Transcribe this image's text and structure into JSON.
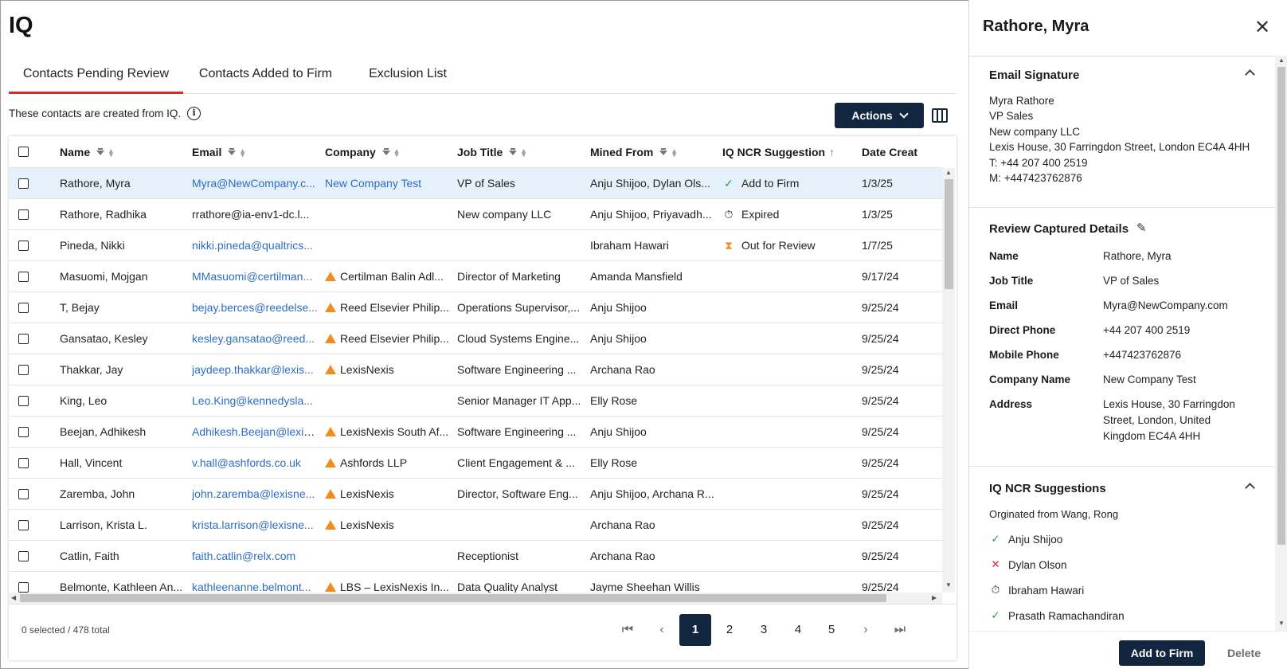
{
  "app": {
    "title": "IQ"
  },
  "tabs": [
    {
      "label": "Contacts Pending Review",
      "active": true
    },
    {
      "label": "Contacts Added to Firm",
      "active": false
    },
    {
      "label": "Exclusion List",
      "active": false
    }
  ],
  "info": {
    "text": "These contacts are created from IQ.",
    "icon": "info-icon"
  },
  "toolbar": {
    "actions_label": "Actions",
    "columns_icon": "columns-icon"
  },
  "table": {
    "columns": [
      "Name",
      "Email",
      "Company",
      "Job Title",
      "Mined From",
      "IQ NCR Suggestion",
      "Date Creat"
    ],
    "rows": [
      {
        "name": "Rathore, Myra",
        "email": "Myra@NewCompany.c...",
        "email_link": true,
        "company": "New Company Test",
        "company_link": true,
        "company_warn": false,
        "job": "VP of Sales",
        "mined": "Anju Shijoo, Dylan Ols...",
        "suggestion": "Add to Firm",
        "sug_icon": "check-icon",
        "date": "1/3/25",
        "selected": true
      },
      {
        "name": "Rathore, Radhika",
        "email": "rrathore@ia-env1-dc.l...",
        "email_link": false,
        "company": "",
        "company_link": false,
        "company_warn": false,
        "job": "New company LLC",
        "mined": "Anju Shijoo, Priyavadh...",
        "suggestion": "Expired",
        "sug_icon": "timer-icon",
        "date": "1/3/25",
        "selected": false
      },
      {
        "name": "Pineda, Nikki",
        "email": "nikki.pineda@qualtrics...",
        "email_link": true,
        "company": "",
        "company_link": false,
        "company_warn": false,
        "job": "",
        "mined": "Ibraham Hawari",
        "suggestion": "Out for Review",
        "sug_icon": "hourglass-icon",
        "date": "1/7/25",
        "selected": false
      },
      {
        "name": "Masuomi, Mojgan",
        "email": "MMasuomi@certilman...",
        "email_link": true,
        "company": "Certilman Balin Adl...",
        "company_link": false,
        "company_warn": true,
        "job": "Director of Marketing",
        "mined": "Amanda Mansfield",
        "suggestion": "",
        "sug_icon": "",
        "date": "9/17/24",
        "selected": false
      },
      {
        "name": "T, Bejay",
        "email": "bejay.berces@reedelse...",
        "email_link": true,
        "company": "Reed Elsevier Philip...",
        "company_link": false,
        "company_warn": true,
        "job": "Operations Supervisor,...",
        "mined": "Anju Shijoo",
        "suggestion": "",
        "sug_icon": "",
        "date": "9/25/24",
        "selected": false
      },
      {
        "name": "Gansatao, Kesley",
        "email": "kesley.gansatao@reed...",
        "email_link": true,
        "company": "Reed Elsevier Philip...",
        "company_link": false,
        "company_warn": true,
        "job": "Cloud Systems Engine...",
        "mined": "Anju Shijoo",
        "suggestion": "",
        "sug_icon": "",
        "date": "9/25/24",
        "selected": false
      },
      {
        "name": "Thakkar, Jay",
        "email": "jaydeep.thakkar@lexis...",
        "email_link": true,
        "company": "LexisNexis",
        "company_link": false,
        "company_warn": true,
        "job": "Software Engineering ...",
        "mined": "Archana Rao",
        "suggestion": "",
        "sug_icon": "",
        "date": "9/25/24",
        "selected": false
      },
      {
        "name": "King, Leo",
        "email": "Leo.King@kennedysla...",
        "email_link": true,
        "company": "",
        "company_link": false,
        "company_warn": false,
        "job": "Senior Manager IT App...",
        "mined": "Elly Rose",
        "suggestion": "",
        "sug_icon": "",
        "date": "9/25/24",
        "selected": false
      },
      {
        "name": "Beejan, Adhikesh",
        "email": "Adhikesh.Beejan@lexis...",
        "email_link": true,
        "company": "LexisNexis South Af...",
        "company_link": false,
        "company_warn": true,
        "job": "Software Engineering ...",
        "mined": "Anju Shijoo",
        "suggestion": "",
        "sug_icon": "",
        "date": "9/25/24",
        "selected": false
      },
      {
        "name": "Hall, Vincent",
        "email": "v.hall@ashfords.co.uk",
        "email_link": true,
        "company": "Ashfords LLP",
        "company_link": false,
        "company_warn": true,
        "job": "Client Engagement & ...",
        "mined": "Elly Rose",
        "suggestion": "",
        "sug_icon": "",
        "date": "9/25/24",
        "selected": false
      },
      {
        "name": "Zaremba, John",
        "email": "john.zaremba@lexisne...",
        "email_link": true,
        "company": "LexisNexis",
        "company_link": false,
        "company_warn": true,
        "job": "Director, Software Eng...",
        "mined": "Anju Shijoo, Archana R...",
        "suggestion": "",
        "sug_icon": "",
        "date": "9/25/24",
        "selected": false
      },
      {
        "name": "Larrison, Krista L.",
        "email": "krista.larrison@lexisne...",
        "email_link": true,
        "company": "LexisNexis",
        "company_link": false,
        "company_warn": true,
        "job": "",
        "mined": "Archana Rao",
        "suggestion": "",
        "sug_icon": "",
        "date": "9/25/24",
        "selected": false
      },
      {
        "name": "Catlin, Faith",
        "email": "faith.catlin@relx.com",
        "email_link": true,
        "company": "",
        "company_link": false,
        "company_warn": false,
        "job": "Receptionist",
        "mined": "Archana Rao",
        "suggestion": "",
        "sug_icon": "",
        "date": "9/25/24",
        "selected": false
      },
      {
        "name": "Belmonte, Kathleen An...",
        "email": "kathleenanne.belmont...",
        "email_link": true,
        "company": "LBS – LexisNexis In...",
        "company_link": false,
        "company_warn": true,
        "job": "Data Quality Analyst",
        "mined": "Jayme Sheehan Willis",
        "suggestion": "",
        "sug_icon": "",
        "date": "9/25/24",
        "selected": false
      }
    ]
  },
  "footer": {
    "count_text": "0 selected / 478 total",
    "pages": [
      "1",
      "2",
      "3",
      "4",
      "5"
    ],
    "current_page": "1"
  },
  "panel": {
    "title": "Rathore, Myra",
    "signature": {
      "title": "Email Signature",
      "lines": [
        "Myra Rathore",
        "VP Sales",
        "New company LLC",
        "Lexis House, 30 Farringdon Street, London EC4A 4HH",
        "T: +44 207 400 2519",
        "M: +447423762876"
      ]
    },
    "review": {
      "title": "Review Captured Details",
      "fields": [
        {
          "label": "Name",
          "value": "Rathore, Myra",
          "link": false
        },
        {
          "label": "Job Title",
          "value": "VP of Sales",
          "link": false
        },
        {
          "label": "Email",
          "value": "Myra@NewCompany.com",
          "link": false
        },
        {
          "label": "Direct Phone",
          "value": "+44 207 400 2519",
          "link": false
        },
        {
          "label": "Mobile Phone",
          "value": "+447423762876",
          "link": false
        },
        {
          "label": "Company Name",
          "value": "New Company Test",
          "link": true
        },
        {
          "label": "Address",
          "value": "Lexis House, 30 Farringdon Street, London, United Kingdom EC4A 4HH",
          "link": false
        }
      ]
    },
    "suggestions": {
      "title": "IQ NCR Suggestions",
      "origin": "Orginated from Wang, Rong",
      "items": [
        {
          "name": "Anju Shijoo",
          "icon": "check-icon"
        },
        {
          "name": "Dylan Olson",
          "icon": "cross-icon"
        },
        {
          "name": "Ibraham Hawari",
          "icon": "timer-icon"
        },
        {
          "name": "Prasath Ramachandiran",
          "icon": "check-icon"
        }
      ]
    },
    "add_label": "Add to Firm",
    "delete_label": "Delete"
  },
  "colors": {
    "primary": "#13263f",
    "tab_active": "#d62d20",
    "link": "#2b6cc4",
    "warning": "#f28c1c",
    "success": "#2e9e44",
    "error": "#d92c2c",
    "selected_row": "#e6f0fb"
  }
}
